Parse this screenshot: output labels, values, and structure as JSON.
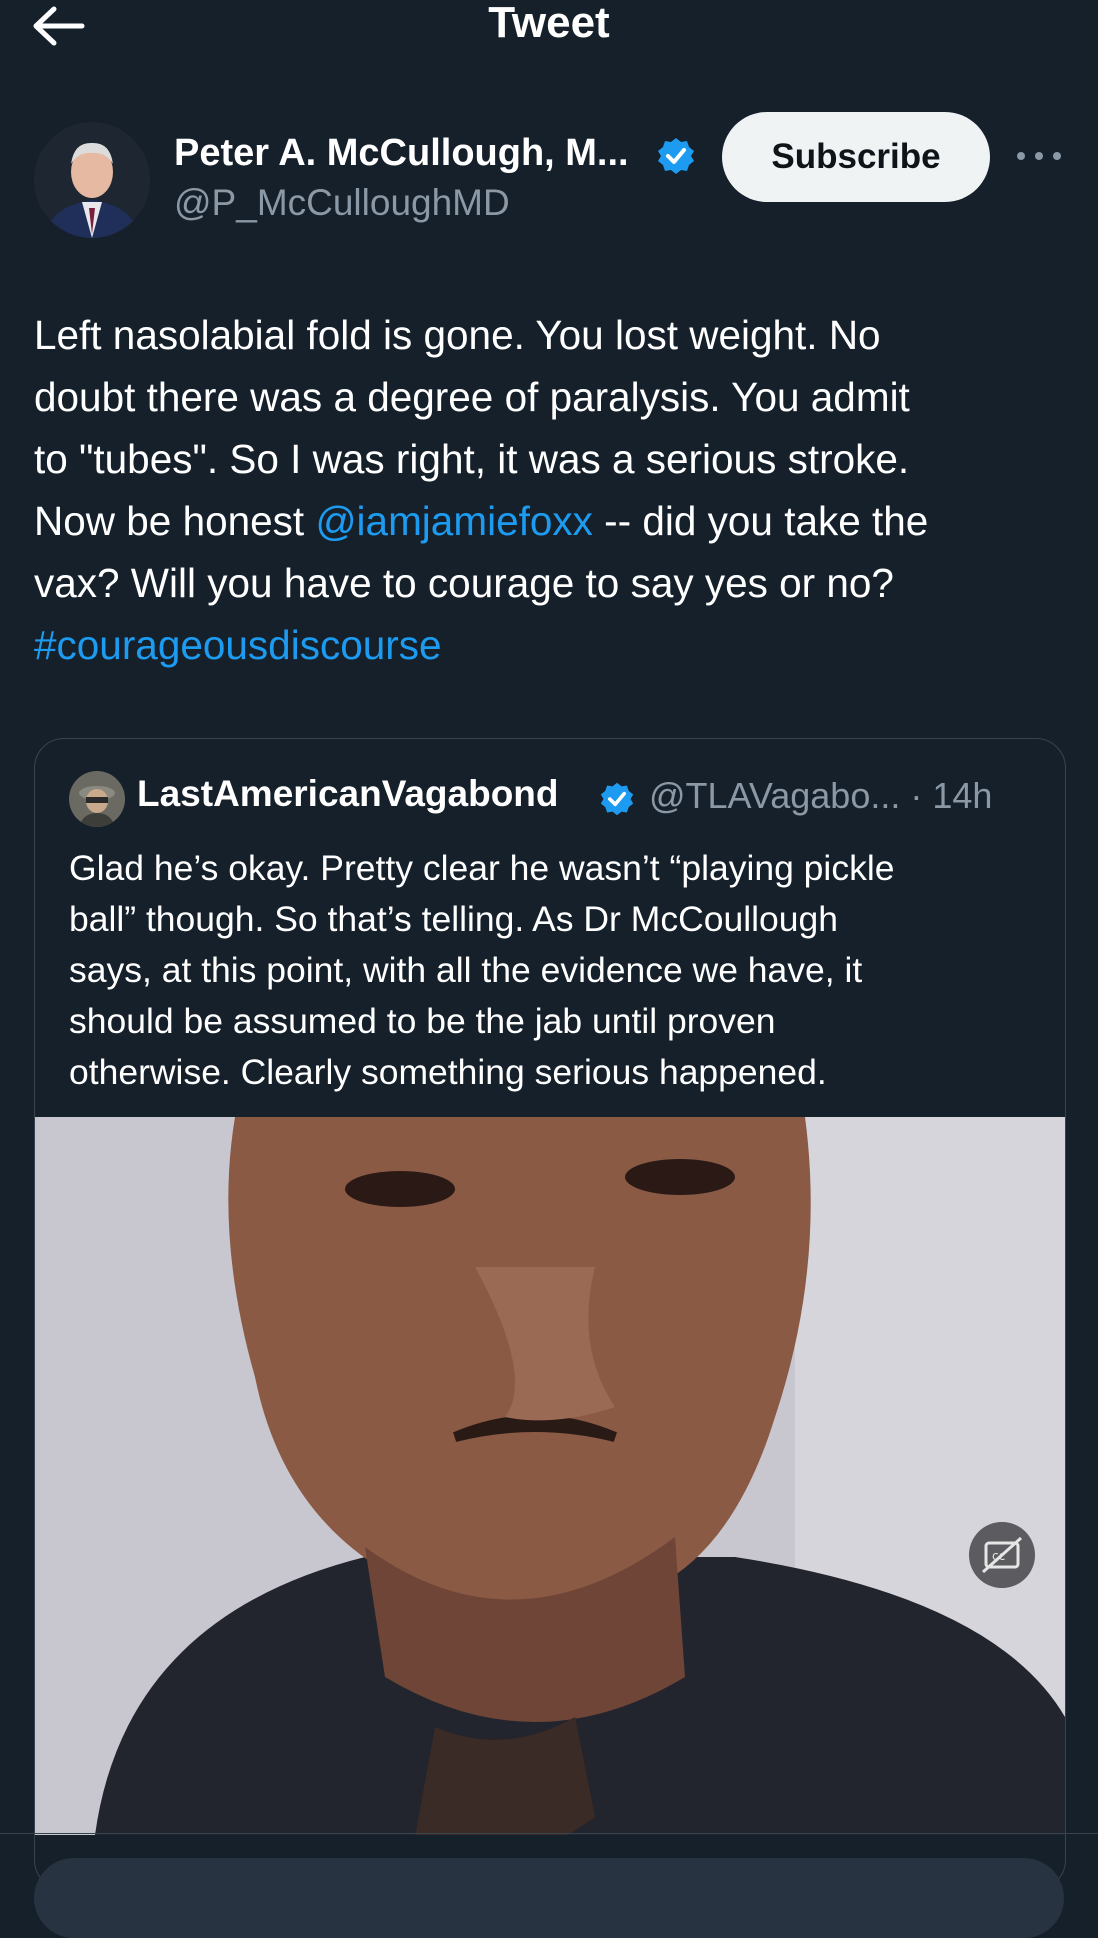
{
  "header": {
    "title": "Tweet",
    "back_icon": "arrow-left-icon"
  },
  "author": {
    "name": "Peter A. McCullough, M...",
    "handle": "@P_McCulloughMD",
    "verified": true,
    "subscribe_label": "Subscribe"
  },
  "tweet": {
    "lines": [
      {
        "text": "Left nasolabial fold is gone.  You lost weight.  No"
      },
      {
        "text": "doubt there was a degree of paralysis.  You admit"
      },
      {
        "text": "to \"tubes\".  So I was right, it was a serious stroke."
      },
      {
        "pre": "Now be honest ",
        "mention": "@iamjamiefoxx",
        "post": " -- did you take the"
      },
      {
        "text": "vax?  Will you have to courage to say yes or no?"
      }
    ],
    "hashtag": "#courageousdiscourse"
  },
  "quote": {
    "name": "LastAmericanVagabond",
    "handle_time": "@TLAVagabo... · 14h",
    "lines": [
      "Glad he’s okay. Pretty clear he wasn’t “playing pickle",
      "ball” though. So that’s telling. As Dr McCoullough",
      "says, at this point, with all the evidence we have, it",
      "should be assumed to be the jab until proven",
      "otherwise. Clearly something serious happened."
    ]
  },
  "colors": {
    "background": "#15202b",
    "link": "#1d9bf0",
    "muted": "#8b98a5",
    "border": "#38444d"
  }
}
